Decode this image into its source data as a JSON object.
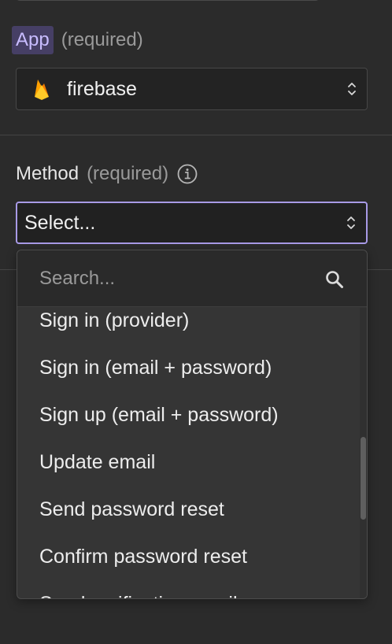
{
  "app_field": {
    "label": "App",
    "required": "(required)",
    "selected": "firebase",
    "icon": "firebase-flame-icon"
  },
  "method_field": {
    "label": "Method",
    "required": "(required)",
    "placeholder": "Select...",
    "info_icon": "info-circle-icon",
    "accent_color": "#a89ae6"
  },
  "dropdown": {
    "search_placeholder": "Search...",
    "options": [
      "Sign in (provider)",
      "Sign in (email + password)",
      "Sign up (email + password)",
      "Update email",
      "Send password reset",
      "Confirm password reset",
      "Send verification email"
    ]
  },
  "colors": {
    "app_tag_bg": "#463f65",
    "app_tag_text": "#c8bcff",
    "panel_bg": "#2b2b2b",
    "dropdown_bg": "#353535"
  }
}
